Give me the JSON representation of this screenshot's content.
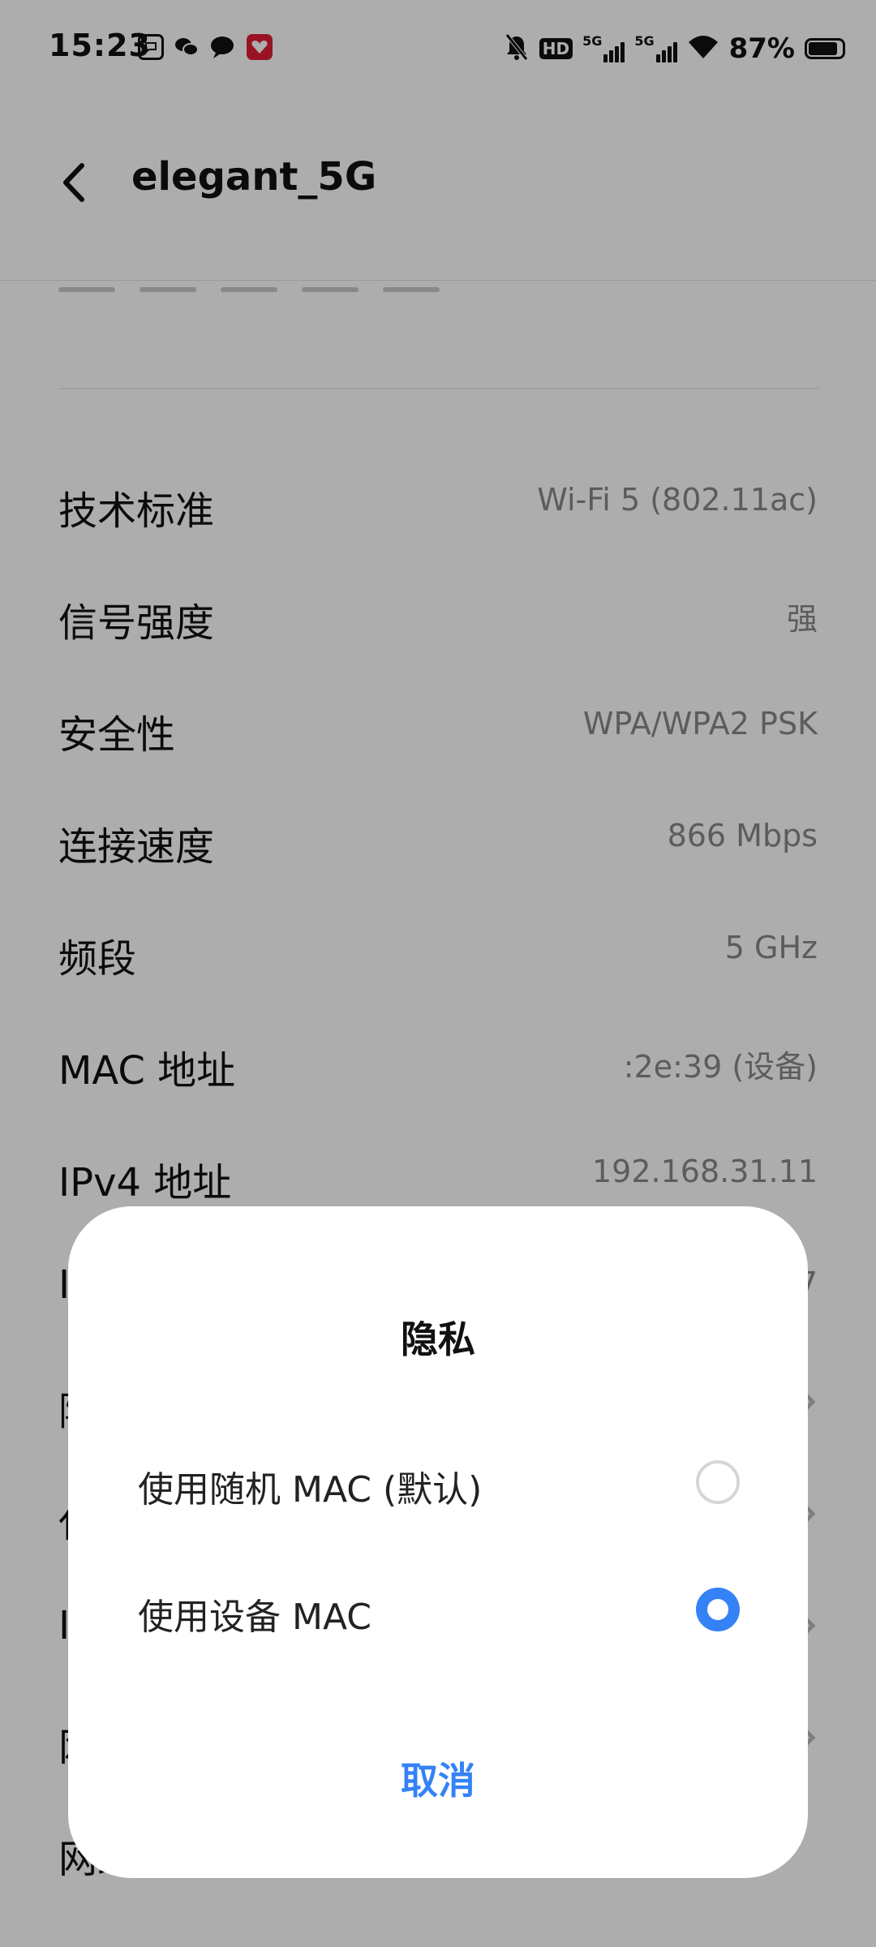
{
  "status_bar": {
    "time": "15:23",
    "hd_label": "HD",
    "net1": "5G",
    "net2": "5G",
    "battery": "87%",
    "battery_level": 0.87,
    "apps": [
      "msg-icon",
      "wechat-icon",
      "chat-icon",
      "red-app-icon"
    ]
  },
  "header": {
    "title": "elegant_5G"
  },
  "rows": [
    {
      "label": "技术标准",
      "value": "Wi-Fi 5 (802.11ac)"
    },
    {
      "label": "信号强度",
      "value": "强"
    },
    {
      "label": "安全性",
      "value": "WPA/WPA2 PSK"
    },
    {
      "label": "连接速度",
      "value": "866 Mbps"
    },
    {
      "label": "频段",
      "value": "5 GHz"
    },
    {
      "label": "MAC 地址",
      "value": ":2e:39 (设备)"
    },
    {
      "label": "IPv4 地址",
      "value": "192.168.31.11"
    },
    {
      "label": "I",
      "value": "7"
    },
    {
      "label": "隐",
      "value": ""
    },
    {
      "label": "代",
      "value": ""
    },
    {
      "label": "I",
      "value": ""
    },
    {
      "label": "网",
      "value": ""
    },
    {
      "label": "网络测速",
      "value": ""
    }
  ],
  "dialog": {
    "title": "隐私",
    "options": [
      {
        "label": "使用随机 MAC (默认)",
        "selected": false
      },
      {
        "label": "使用设备 MAC",
        "selected": true
      }
    ],
    "cancel": "取消"
  },
  "colors": {
    "accent": "#3482f6",
    "scrim": "rgba(0,0,0,0.32)",
    "value_text": "#888888"
  }
}
